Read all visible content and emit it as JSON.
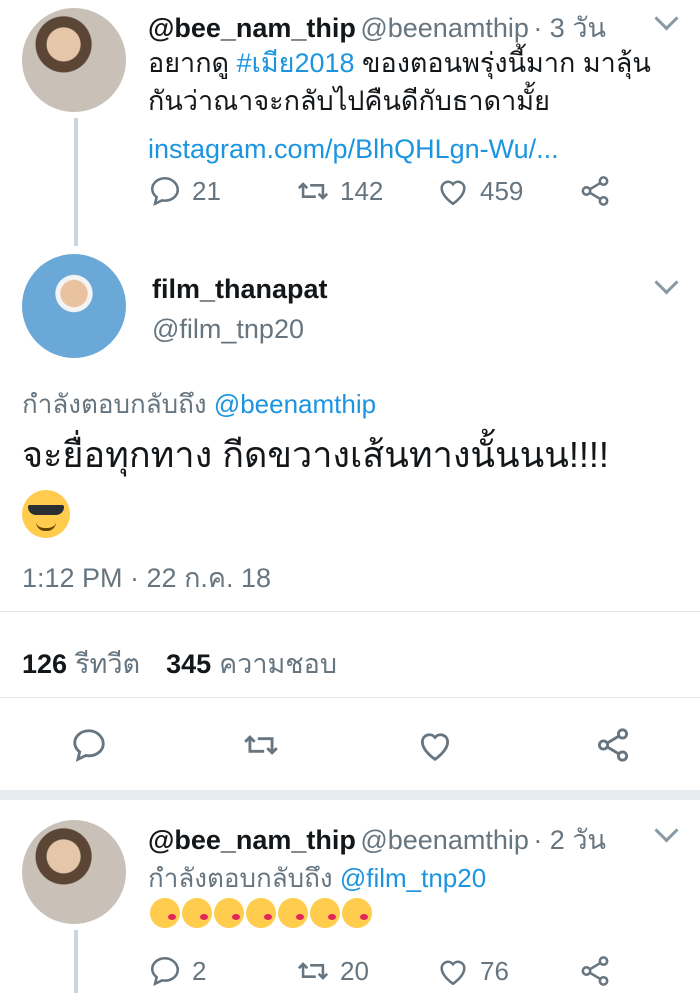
{
  "tweet1": {
    "name": "@bee_nam_thip",
    "handle": "@beenamthip",
    "time": "· 3 วัน",
    "text_before_tag": "อยากดู ",
    "hashtag": "#เมีย2018",
    "text_after_tag": " ของตอนพรุ่งนี้มาก มาลุ้น",
    "text_line2": "กันว่าณาจะกลับไปคืนดีกับธาดามั้ย",
    "link": "instagram.com/p/BlhQHLgn-Wu/...",
    "replies": "21",
    "retweets": "142",
    "likes": "459"
  },
  "tweet2": {
    "name": "film_thanapat",
    "handle": "@film_tnp20",
    "reply_prefix": "กำลังตอบกลับถึง",
    "reply_to": "@beenamthip",
    "text": "จะยื่อทุกทาง กีดขวางเส้นทางนั้นนน!!!!",
    "timestamp": "1:12 PM · 22 ก.ค. 18",
    "retweet_count": "126",
    "retweet_label": "รีทวีต",
    "like_count": "345",
    "like_label": "ความชอบ"
  },
  "tweet3": {
    "name": "@bee_nam_thip",
    "handle": "@beenamthip",
    "time": "· 2 วัน",
    "reply_prefix": "กำลังตอบกลับถึง",
    "reply_to": "@film_tnp20",
    "replies": "2",
    "retweets": "20",
    "likes": "76"
  },
  "icons": {
    "reply": "reply-icon",
    "retweet": "retweet-icon",
    "like": "heart-icon",
    "share": "share-icon",
    "menu": "chevron-down-icon"
  },
  "colors": {
    "link": "#1b95e0",
    "secondary_text": "#66757f",
    "divider": "#e1e8ed"
  }
}
